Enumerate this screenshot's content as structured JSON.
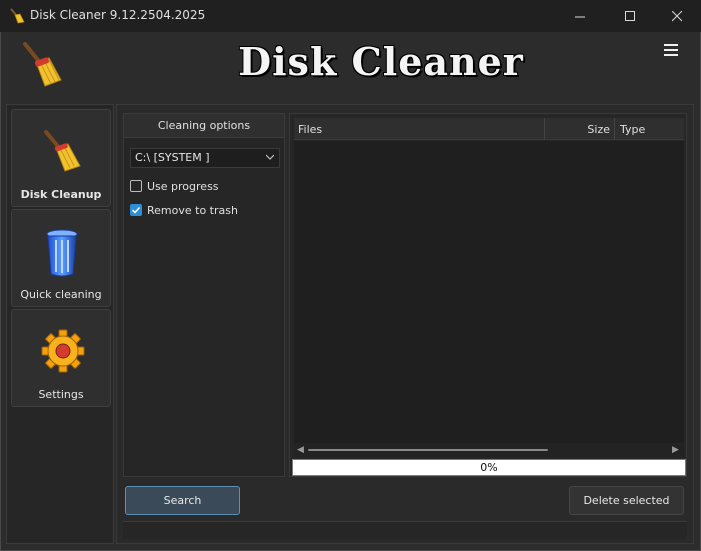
{
  "window": {
    "title": "Disk Cleaner 9.12.2504.2025",
    "controls": {
      "minimize": "—",
      "maximize": "☐",
      "close": "✕"
    }
  },
  "header": {
    "title": "Disk Cleaner",
    "logo_icon": "broom-icon",
    "menu_icon": "hamburger-menu-icon"
  },
  "sidebar": {
    "items": [
      {
        "label": "Disk Cleanup",
        "icon": "broom-icon",
        "active": true
      },
      {
        "label": "Quick cleaning",
        "icon": "trash-bin-icon",
        "active": false
      },
      {
        "label": "Settings",
        "icon": "gear-icon",
        "active": false
      }
    ]
  },
  "options": {
    "header": "Cleaning options",
    "drive_selected": "C:\\ [SYSTEM ]",
    "use_progress": {
      "label": "Use progress",
      "checked": false
    },
    "remove_to_trash": {
      "label": "Remove to trash",
      "checked": true
    }
  },
  "file_list": {
    "columns": [
      "Files",
      "Size",
      "Type"
    ],
    "rows": []
  },
  "progress": {
    "text": "0%",
    "value": 0
  },
  "buttons": {
    "search": "Search",
    "delete_selected": "Delete selected"
  },
  "colors": {
    "accent": "#2d8fd6",
    "background": "#2b2b2b",
    "titlebar": "#202020"
  }
}
